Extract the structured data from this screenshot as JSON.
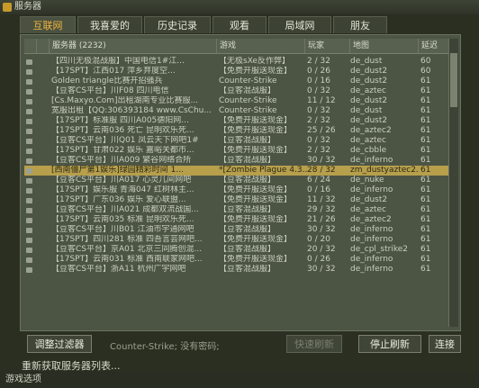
{
  "window": {
    "title": "服务器",
    "tabs": [
      {
        "label": "互联网",
        "active": true
      },
      {
        "label": "我喜爱的",
        "active": false
      },
      {
        "label": "历史记录",
        "active": false
      },
      {
        "label": "观看",
        "active": false
      },
      {
        "label": "局域网",
        "active": false
      },
      {
        "label": "朋友",
        "active": false
      }
    ]
  },
  "table": {
    "headers": {
      "name": "服务器 (2232)",
      "game": "游戏",
      "players": "玩家",
      "map": "地图",
      "latency": "延迟"
    },
    "rows": [
      {
        "name": "【四川无极混战服】中国电信1#江...",
        "game": "【无极sXe反作弊】",
        "players": "2 / 32",
        "map": "de_dust",
        "latency": "60",
        "selected": false
      },
      {
        "name": "【17SPT】江西017 萍乡弃度空...",
        "game": "【免费开服送现金】",
        "players": "0 / 26",
        "map": "de_dust2",
        "latency": "60",
        "selected": false
      },
      {
        "name": "Golden triangle比赛开招骚兵",
        "game": "Counter-Strike",
        "players": "0 / 16",
        "map": "de_dust2",
        "latency": "61",
        "selected": false
      },
      {
        "name": "【豆客CS平台】川F08 四川电信",
        "game": "【豆客混战服】",
        "players": "0 / 32",
        "map": "de_aztec",
        "latency": "61",
        "selected": false
      },
      {
        "name": "[Cs.Maxyo.Com]出租湖南专业比赛服...",
        "game": "Counter-Strike",
        "players": "11 / 12",
        "map": "de_dust2",
        "latency": "61",
        "selected": false
      },
      {
        "name": "宽服出租【QQ:306393184 www.CsChu...",
        "game": "Counter-Strike",
        "players": "0 / 32",
        "map": "de_dust",
        "latency": "61",
        "selected": false
      },
      {
        "name": "【17SPT】标准服 四川A005德阳网...",
        "game": "【免费开服送现金】",
        "players": "2 / 32",
        "map": "de_dust2",
        "latency": "61",
        "selected": false
      },
      {
        "name": "【17SPT】云南036 死亡 昆明欢乐死...",
        "game": "【免费开服送现金】",
        "players": "25 / 26",
        "map": "de_aztec2",
        "latency": "61",
        "selected": false
      },
      {
        "name": "【豆客CS平台】川Q01 凤云天下网吧1#",
        "game": "【豆客混战服】",
        "players": "0 / 32",
        "map": "de_aztec",
        "latency": "61",
        "selected": false
      },
      {
        "name": "【17SPT】甘肃022 娱乐 嘉峪关都市...",
        "game": "【免费开服送现金】",
        "players": "2 / 32",
        "map": "de_cbble",
        "latency": "61",
        "selected": false
      },
      {
        "name": "【豆客CS平台】川A009 繁谷网络合所",
        "game": "【豆客混战服】",
        "players": "30 / 32",
        "map": "de_inferno",
        "latency": "61",
        "selected": false
      },
      {
        "name": "[西南僵尸第1娱乐]绿园精彩时间 1...",
        "game": "*[Zombie Plague 4.3...",
        "players": "28 / 32",
        "map": "zm_dustyaztec2...",
        "latency": "61",
        "selected": true
      },
      {
        "name": "【豆客CS平台】川A017 心灵儿间网吧",
        "game": "【豆客混战服】",
        "players": "6 / 24",
        "map": "de_nuke",
        "latency": "61",
        "selected": false
      },
      {
        "name": "【17SPT】娱乐服 青海047 红树林主...",
        "game": "【免费开服送现金】",
        "players": "0 / 16",
        "map": "de_inferno",
        "latency": "61",
        "selected": false
      },
      {
        "name": "【17SPT】广东036 娱乐 爱心联盟...",
        "game": "【免费开服送现金】",
        "players": "11 / 32",
        "map": "de_dust2",
        "latency": "61",
        "selected": false
      },
      {
        "name": "【豆客CS平台】川A021 成都双流战国...",
        "game": "【豆客混战服】",
        "players": "29 / 32",
        "map": "de_aztec",
        "latency": "61",
        "selected": false
      },
      {
        "name": "【17SPT】云南035 标准 昆明欢乐死...",
        "game": "【免费开服送现金】",
        "players": "21 / 26",
        "map": "de_aztec2",
        "latency": "61",
        "selected": false
      },
      {
        "name": "【豆客CS平台】川B01 江油市宇通网吧",
        "game": "【豆客混战服】",
        "players": "30 / 32",
        "map": "de_inferno",
        "latency": "61",
        "selected": false
      },
      {
        "name": "【17SPT】四川281 标准 四吾言芸网吧...",
        "game": "【免费开服送现金】",
        "players": "0 / 20",
        "map": "de_inferno",
        "latency": "61",
        "selected": false
      },
      {
        "name": "【豆客CS平台】京A01 北京三同腾创混...",
        "game": "【豆客混战服】",
        "players": "20 / 32",
        "map": "de_cpl_strike2",
        "latency": "61",
        "selected": false
      },
      {
        "name": "【17SPT】云南031 标准 西南联家网吧...",
        "game": "【免费开服送现金】",
        "players": "0 / 26",
        "map": "de_inferno",
        "latency": "61",
        "selected": false
      },
      {
        "name": "【豆客CS平台】浙A11 杭州广宇网吧",
        "game": "【豆客混战服】",
        "players": "30 / 32",
        "map": "de_inferno",
        "latency": "61",
        "selected": false
      }
    ]
  },
  "footer": {
    "filter_button": "调整过滤器",
    "status": "Counter-Strike; 没有密码;",
    "quick_refresh_button": "快速刷新",
    "stop_refresh_button": "停止刷新",
    "connect_button": "连接",
    "refresh_list_link": "重新获取服务器列表..."
  },
  "taskbar": {
    "text": "游戏选项"
  }
}
